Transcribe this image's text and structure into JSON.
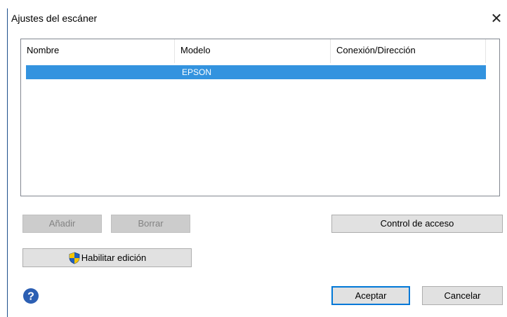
{
  "window": {
    "title": "Ajustes del escáner",
    "close_glyph": "✕"
  },
  "scanner_list": {
    "columns": [
      "Nombre",
      "Modelo",
      "Conexión/Dirección"
    ],
    "rows": [
      {
        "nombre": "",
        "modelo": "EPSON",
        "conexion": "",
        "selected": true
      }
    ]
  },
  "buttons": {
    "add_label": "Añadir",
    "add_enabled": false,
    "delete_label": "Borrar",
    "delete_enabled": false,
    "access_control_label": "Control de acceso",
    "enable_edit_label": "Habilitar edición",
    "ok_label": "Aceptar",
    "cancel_label": "Cancelar"
  },
  "icons": {
    "help": "help-icon",
    "shield": "uac-shield-icon"
  },
  "colors": {
    "selection": "#3393df",
    "window_border": "#1e4f8c",
    "help_icon": "#2c5fb3",
    "primary_button_border": "#0078d7"
  }
}
